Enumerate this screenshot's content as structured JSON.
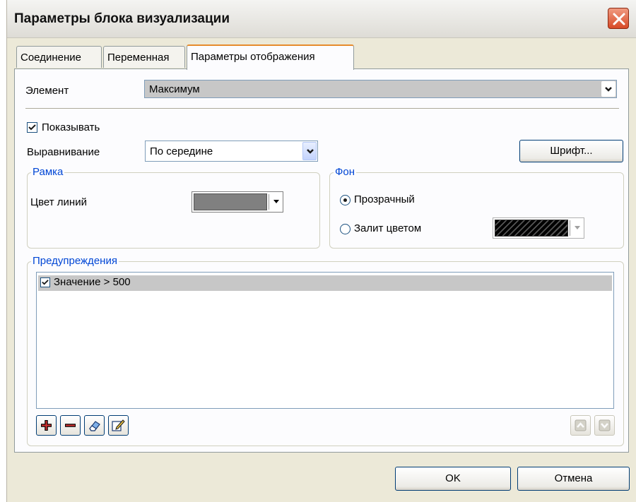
{
  "window": {
    "title": "Параметры блока визуализации"
  },
  "tabs": [
    {
      "label": "Соединение",
      "active": false
    },
    {
      "label": "Переменная",
      "active": false
    },
    {
      "label": "Параметры отображения",
      "active": true
    }
  ],
  "element": {
    "label": "Элемент",
    "value": "Максимум"
  },
  "show": {
    "label": "Показывать",
    "checked": true
  },
  "alignment": {
    "label": "Выравнивание",
    "value": "По середине"
  },
  "font_button": {
    "label": "Шрифт..."
  },
  "frame_group": {
    "title": "Рамка",
    "line_color_label": "Цвет линий",
    "line_color": "#808080"
  },
  "background_group": {
    "title": "Фон",
    "transparent_label": "Прозрачный",
    "filled_label": "Залит цветом",
    "selected": "transparent",
    "fill_color": "#000000"
  },
  "warnings_group": {
    "title": "Предупреждения",
    "items": [
      {
        "text": "Значение > 500",
        "checked": true
      }
    ]
  },
  "toolbar": {
    "add_icon": "plus-icon",
    "remove_icon": "minus-icon",
    "clear_icon": "eraser-icon",
    "edit_icon": "edit-pencil-icon",
    "up_icon": "arrow-up-icon",
    "down_icon": "arrow-down-icon"
  },
  "buttons": {
    "ok": "OK",
    "cancel": "Отмена"
  },
  "colors": {
    "accent_tab": "#e68b2c",
    "group_title": "#0046d5",
    "close_button": "#d84a27"
  }
}
